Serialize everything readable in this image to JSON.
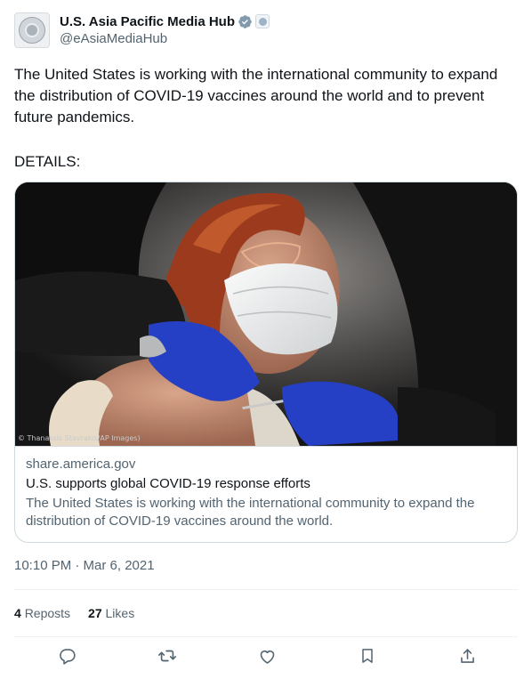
{
  "author": {
    "display_name": "U.S. Asia Pacific Media Hub",
    "handle": "@eAsiaMediaHub"
  },
  "tweet": {
    "text": "The United States is working with the international community to expand the distribution of COVID-19 vaccines around the world and to prevent future pandemics.",
    "details": "DETAILS:"
  },
  "card": {
    "photo_credit": "© Thanassis Stavrakis/AP Images)",
    "domain": "share.america.gov",
    "title": "U.S. supports global COVID-19 response efforts",
    "description": "The United States is working with the international community to expand the distribution of COVID-19 vaccines around the world."
  },
  "timestamp": "10:10 PM · Mar 6, 2021",
  "stats": {
    "reposts_count": "4",
    "reposts_label": "Reposts",
    "likes_count": "27",
    "likes_label": "Likes"
  },
  "icons": {
    "verified": "verified-badge-icon",
    "affiliate": "affiliate-seal-icon",
    "reply": "reply-icon",
    "repost": "repost-icon",
    "like": "like-icon",
    "bookmark": "bookmark-icon",
    "share": "share-icon"
  },
  "colors": {
    "text_primary": "#0f1419",
    "text_secondary": "#536471",
    "verified_badge": "#829aab",
    "border": "#cfd9de",
    "glove_blue": "#2540c4"
  }
}
